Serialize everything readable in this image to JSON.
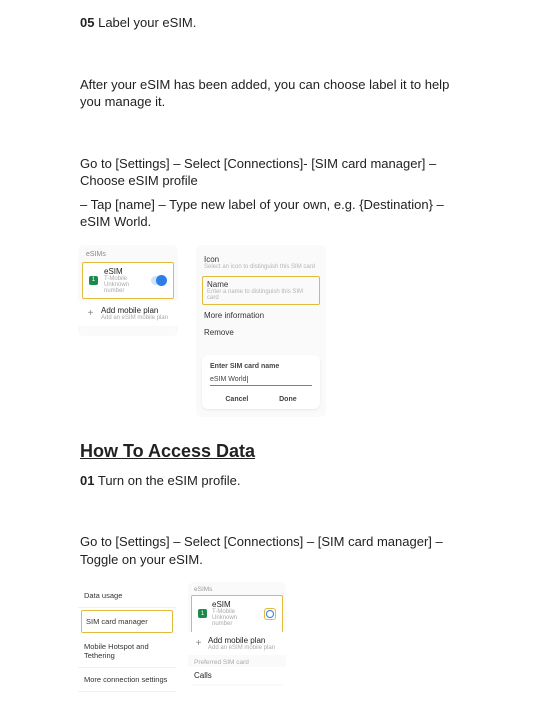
{
  "step05": {
    "num": "05",
    "title": "Label your eSIM."
  },
  "p_after": "After your eSIM has been added, you can choose label it to help you manage it.",
  "p_goto1": "Go to [Settings] – Select [Connections]- [SIM card manager] – Choose eSIM profile",
  "p_tap": "– Tap [name] – Type new label of your own, e.g. {Destination} – eSIM World.",
  "fig1": {
    "leftHead": "eSIMs",
    "esim": {
      "title": "eSIM",
      "sub1": "T-Mobile",
      "sub2": "Unknown number",
      "badge": "1"
    },
    "add": {
      "title": "Add mobile plan",
      "sub": "Add an eSIM mobile plan"
    },
    "right": {
      "iconLbl": "Icon",
      "iconSub": "Select an icon to distinguish this SIM card",
      "nameLbl": "Name",
      "nameSub": "Enter a name to distinguish this SIM card",
      "more": "More information",
      "remove": "Remove"
    },
    "modal": {
      "title": "Enter SIM card name",
      "value": "eSIM World",
      "cancel": "Cancel",
      "done": "Done"
    }
  },
  "sectionAccess": "How To Access Data",
  "step01": {
    "num": "01",
    "title": "Turn on the eSIM profile."
  },
  "p_goto2": "Go to [Settings] – Select [Connections] – [SIM card manager] – Toggle on your eSIM.",
  "fig2": {
    "left": {
      "r1": "Data usage",
      "r2": "SIM card manager",
      "r3": "Mobile Hotspot and Tethering",
      "r4": "More connection settings"
    },
    "right": {
      "head": "eSIMs",
      "esimTitle": "eSIM",
      "esimSub1": "T-Mobile",
      "esimSub2": "Unknown number",
      "badge": "1",
      "addTitle": "Add mobile plan",
      "addSub": "Add an eSIM mobile plan",
      "sec1": "Preferred SIM card",
      "calls": "Calls"
    }
  }
}
